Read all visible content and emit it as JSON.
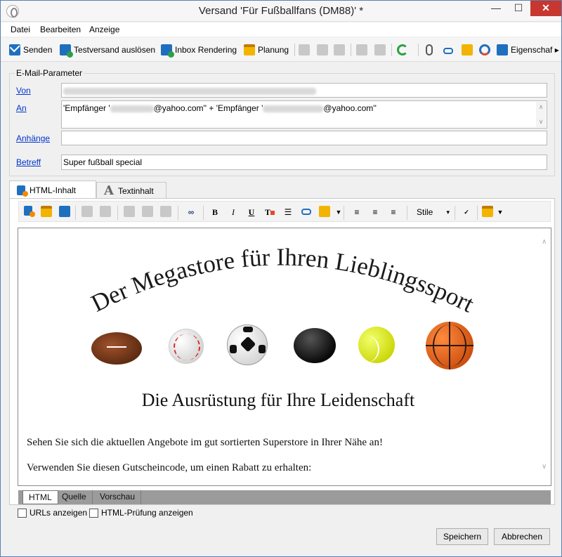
{
  "window": {
    "title": "Versand 'Für Fußballfans (DM88)' *",
    "minimize": "—",
    "maximize": "☐",
    "close": "✕"
  },
  "menu": [
    "Datei",
    "Bearbeiten",
    "Anzeige"
  ],
  "toolbar": {
    "send": "Senden",
    "test_send": "Testversand auslösen",
    "inbox_rendering": "Inbox Rendering",
    "schedule": "Planung",
    "properties": "Eigenschaf ▸"
  },
  "email_params": {
    "legend": "E-Mail-Parameter",
    "from_label": "Von",
    "to_label": "An",
    "to_value_prefix_1": "'Empfänger '",
    "to_value_domain_1": "@yahoo.com'' + 'Empfänger '",
    "to_value_domain_2": "@yahoo.com''",
    "attachments_label": "Anhänge",
    "subject_label": "Betreff",
    "subject_value": "Super fußball special"
  },
  "tabs": {
    "html": "HTML-Inhalt",
    "text": "Textinhalt"
  },
  "editor": {
    "bold": "B",
    "italic": "I",
    "underline": "U",
    "styles": "Stile",
    "styles_caret": "▾"
  },
  "content": {
    "arch_title": "Der Megastore für Ihren Lieblingssport",
    "subhead": "Die Ausrüstung für Ihre Leidenschaft",
    "para1": "Sehen Sie sich die aktuellen Angebote im gut sortierten Superstore in Ihrer Nähe an!",
    "para2": "Verwenden Sie diesen Gutscheincode, um einen Rabatt zu erhalten:"
  },
  "view_tabs": [
    "HTML",
    "Quelle",
    "Vorschau"
  ],
  "options": {
    "show_urls": "URLs anzeigen",
    "show_html_check": "HTML-Prüfung anzeigen"
  },
  "buttons": {
    "save": "Speichern",
    "cancel": "Abbrechen"
  },
  "colors": {
    "accent": "#1f6fbf",
    "link": "#0033cc",
    "close": "#c7372f"
  }
}
